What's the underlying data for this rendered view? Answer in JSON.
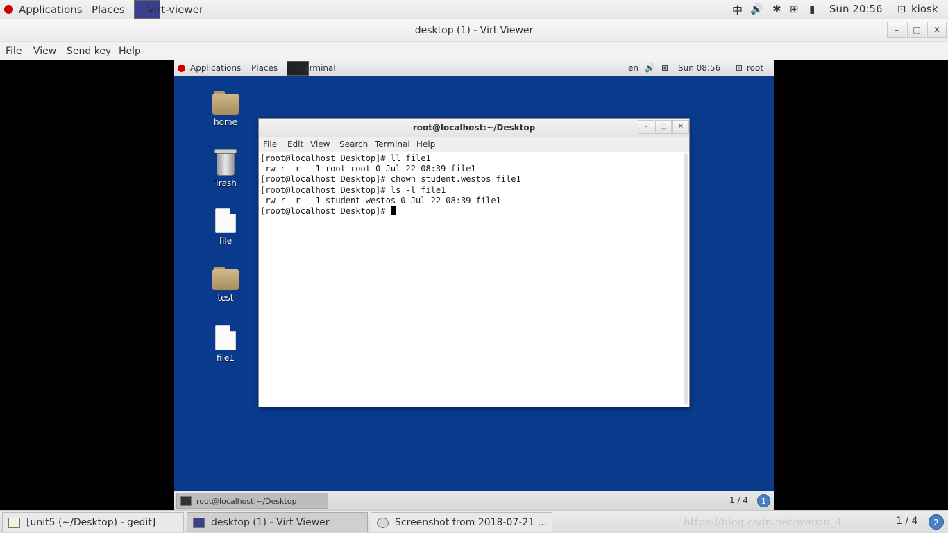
{
  "host_panel": {
    "applications": "Applications",
    "places": "Places",
    "task_title": "Virt-viewer",
    "input_method": "中",
    "clock": "Sun 20:56",
    "user": "kiosk"
  },
  "viewer": {
    "title": "desktop (1) - Virt Viewer",
    "menu": {
      "file": "File",
      "view": "View",
      "send_key": "Send key",
      "help": "Help"
    },
    "window_buttons": {
      "minimize": "–",
      "maximize": "□",
      "close": "✕"
    }
  },
  "guest": {
    "panel": {
      "applications": "Applications",
      "places": "Places",
      "task": "Terminal",
      "lang": "en",
      "clock": "Sun 08:56",
      "user": "root"
    },
    "desktop_icons": [
      {
        "label": "home",
        "icon": "home-folder-icon"
      },
      {
        "label": "Trash",
        "icon": "trash-icon"
      },
      {
        "label": "file",
        "icon": "document-icon"
      },
      {
        "label": "test",
        "icon": "folder-icon"
      },
      {
        "label": "file1",
        "icon": "document-icon"
      }
    ],
    "terminal": {
      "title": "root@localhost:~/Desktop",
      "menu": {
        "file": "File",
        "edit": "Edit",
        "view": "View",
        "search": "Search",
        "terminal": "Terminal",
        "help": "Help"
      },
      "lines": [
        "[root@localhost Desktop]# ll file1",
        "-rw-r--r-- 1 root root 0 Jul 22 08:39 file1",
        "[root@localhost Desktop]# chown student.westos file1",
        "[root@localhost Desktop]# ls -l file1",
        "-rw-r--r-- 1 student westos 0 Jul 22 08:39 file1"
      ],
      "prompt": "[root@localhost Desktop]# "
    },
    "bottom": {
      "task": "root@localhost:~/Desktop",
      "pager": "1 / 4",
      "workspace": "1"
    }
  },
  "host_bottom": {
    "tasks": [
      "[unit5 (~/Desktop) - gedit]",
      "desktop (1) - Virt Viewer",
      "Screenshot from 2018-07-21 ..."
    ],
    "watermark": "https://blog.csdn.net/weixin_4",
    "pager": "1 / 4",
    "workspace": "2"
  },
  "colors": {
    "guest_desktop": "#0a3a8c",
    "redhat": "#cc0000"
  }
}
